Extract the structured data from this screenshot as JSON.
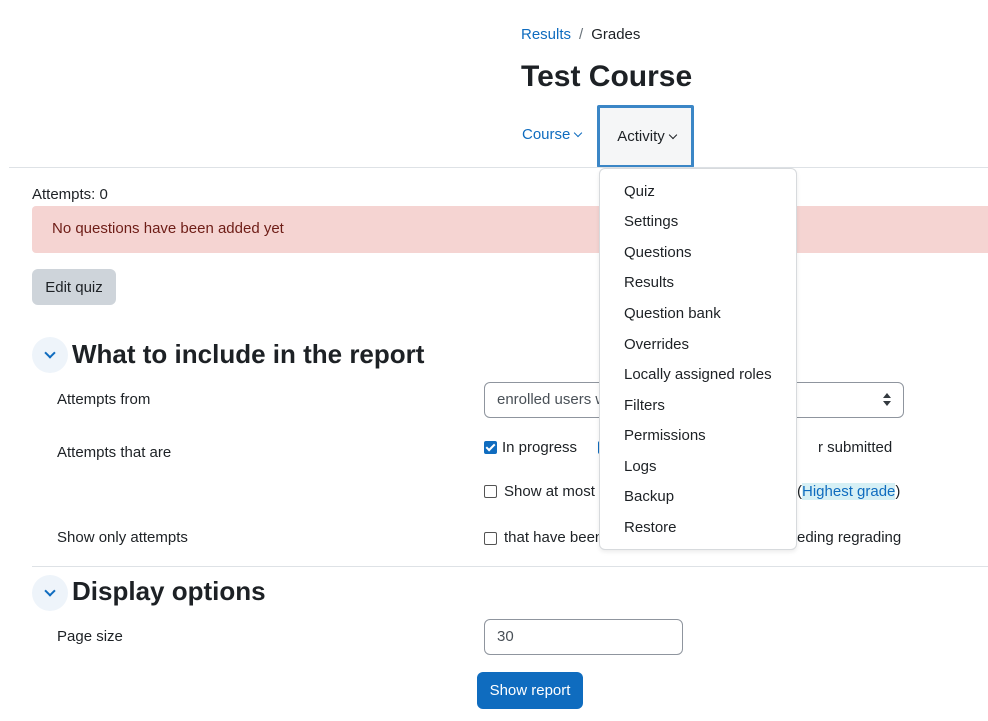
{
  "breadcrumb": {
    "link": "Results",
    "separator": "/",
    "current": "Grades"
  },
  "page_title": "Test Course",
  "nav": {
    "course": "Course",
    "activity": "Activity"
  },
  "attempts_text": "Attempts: 0",
  "alert_text": "No questions have been added yet",
  "edit_quiz_label": "Edit quiz",
  "section_report": {
    "title": "What to include in the report",
    "attempts_from_label": "Attempts from",
    "attempts_from_value": "enrolled users w",
    "attempts_that_are_label": "Attempts that are",
    "in_progress": "In progress",
    "submitted_tail": "r submitted",
    "show_at_most": "Show at most",
    "paren_open": "(",
    "highest_grade": "Highest grade",
    "paren_close": ")",
    "show_only_label": "Show only attempts",
    "that_have_been": "that have been",
    "needing_regrading_tail": "eding regrading"
  },
  "section_display": {
    "title": "Display options",
    "page_size_label": "Page size",
    "page_size_value": "30"
  },
  "show_report_label": "Show report",
  "menu_items": [
    "Quiz",
    "Settings",
    "Questions",
    "Results",
    "Question bank",
    "Overrides",
    "Locally assigned roles",
    "Filters",
    "Permissions",
    "Logs",
    "Backup",
    "Restore"
  ],
  "colors": {
    "link": "#0f6cbf",
    "alert_bg": "#f5d4d2",
    "alert_text": "#6e1d17",
    "primary": "#0f6cbf"
  }
}
